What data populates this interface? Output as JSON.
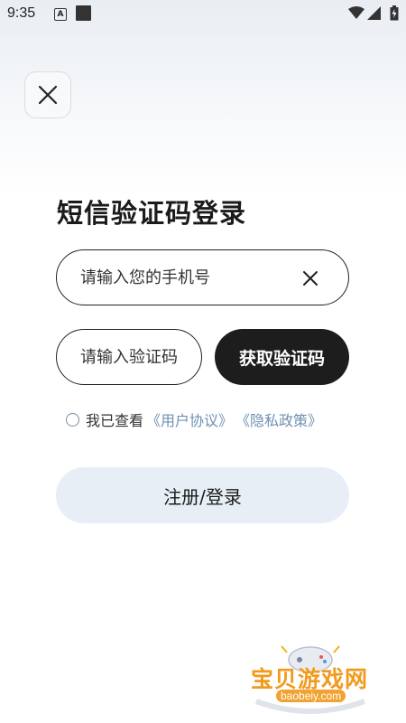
{
  "status_bar": {
    "time": "9:35",
    "a_icon_letter": "A"
  },
  "login": {
    "title": "短信验证码登录",
    "phone_placeholder": "请输入您的手机号",
    "code_placeholder": "请输入验证码",
    "get_code_label": "获取验证码",
    "agree_text": "我已查看",
    "user_agreement": "《用户协议》",
    "privacy_policy": "《隐私政策》",
    "submit_label": "注册/登录"
  },
  "watermark": {
    "title": "宝贝游戏网",
    "url": "baobeiy.com"
  },
  "colors": {
    "primary_dark": "#1d1d1d",
    "link": "#6f90b4",
    "submit_bg": "#e7eef6"
  }
}
